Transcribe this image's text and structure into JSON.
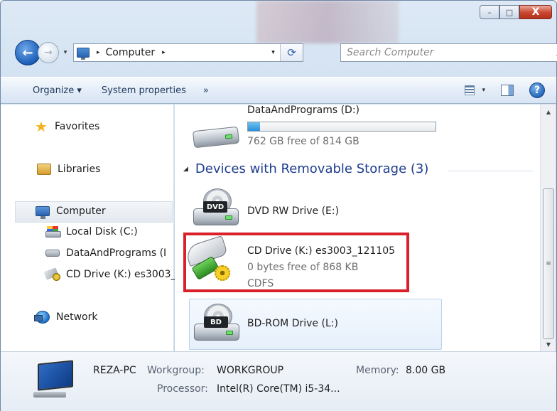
{
  "window": {
    "minimize_label": "–",
    "maximize_label": "□",
    "close_label": "X"
  },
  "nav": {
    "back_label": "←",
    "forward_label": "→",
    "dropdown_label": "▾",
    "address_separator": "▸",
    "address_text": "Computer",
    "address_trailing_separator": "▸",
    "address_dropdown_label": "▾",
    "refresh_label": "⟳",
    "search_placeholder": "Search Computer",
    "search_icon": "⌕"
  },
  "toolbar": {
    "organize_label": "Organize ▾",
    "system_properties_label": "System properties",
    "more_label": "»",
    "views_dropdown": "▾",
    "help_label": "?"
  },
  "sidebar": {
    "items": [
      {
        "label": "Favorites",
        "icon": "star-icon"
      },
      {
        "label": "Libraries",
        "icon": "libraries-icon"
      },
      {
        "label": "Computer",
        "icon": "computer-icon"
      },
      {
        "label": "Local Disk (C:)",
        "icon": "local-disk-icon"
      },
      {
        "label": "DataAndPrograms (I",
        "icon": "drive-icon"
      },
      {
        "label": "CD Drive (K:) es3003_",
        "icon": "cd-drive-icon"
      },
      {
        "label": "Network",
        "icon": "network-icon"
      }
    ]
  },
  "content": {
    "partial_drive": {
      "name": "DataAndPrograms (D:)",
      "free_text": "762 GB free of 814 GB",
      "used_fraction": 0.064
    },
    "group_header": "Devices with Removable Storage (3)",
    "group_toggle": "◢",
    "drives": [
      {
        "name": "DVD RW Drive (E:)",
        "badge": "DVD"
      },
      {
        "name": "CD Drive (K:) es3003_121105",
        "free_text": "0 bytes free of 868 KB",
        "fs": "CDFS"
      },
      {
        "name": "BD-ROM Drive (L:)",
        "badge": "BD"
      }
    ]
  },
  "scrollbar": {
    "up": "▲",
    "down": "▼",
    "grip": "≡"
  },
  "status": {
    "pc_name": "REZA-PC",
    "workgroup_key": "Workgroup:",
    "workgroup_value": "WORKGROUP",
    "memory_key": "Memory:",
    "memory_value": "8.00 GB",
    "processor_key": "Processor:",
    "processor_value": "Intel(R) Core(TM) i5-34..."
  },
  "colors": {
    "highlight_border": "#d9202b",
    "group_header": "#1e3d8f",
    "progress_fill": "#2a8fd8"
  }
}
